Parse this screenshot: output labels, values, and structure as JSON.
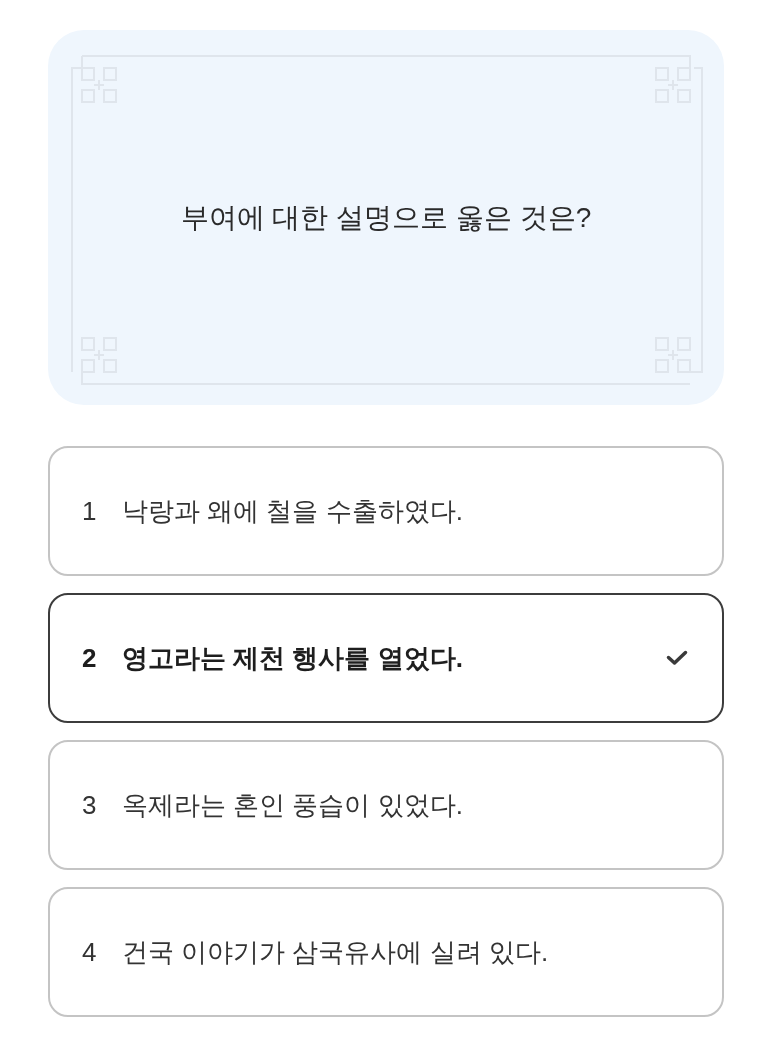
{
  "question": {
    "text": "부여에 대한 설명으로 옳은 것은?"
  },
  "options": [
    {
      "number": "1",
      "text": "낙랑과 왜에 철을 수출하였다.",
      "selected": false
    },
    {
      "number": "2",
      "text": "영고라는 제천 행사를 열었다.",
      "selected": true
    },
    {
      "number": "3",
      "text": "옥제라는 혼인 풍습이 있었다.",
      "selected": false
    },
    {
      "number": "4",
      "text": "건국 이야기가 삼국유사에 실려 있다.",
      "selected": false
    }
  ]
}
